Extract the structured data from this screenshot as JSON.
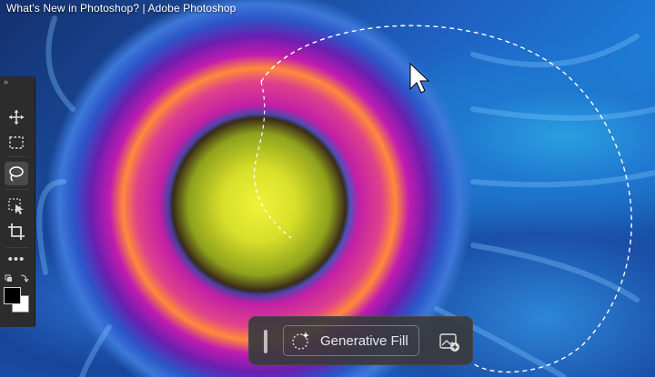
{
  "window": {
    "title": "What's New in Photoshop? | Adobe Photoshop"
  },
  "toolbar": {
    "collapse_glyph": "»",
    "tools": [
      {
        "name": "move-tool",
        "icon": "move-icon",
        "active": false
      },
      {
        "name": "marquee-tool",
        "icon": "rect-marquee-icon",
        "active": false
      },
      {
        "name": "lasso-tool",
        "icon": "lasso-icon",
        "active": true
      },
      {
        "name": "object-selection-tool",
        "icon": "object-select-icon",
        "active": false
      },
      {
        "name": "crop-tool",
        "icon": "crop-icon",
        "active": false
      },
      {
        "name": "more-tools",
        "icon": "more-icon",
        "active": false
      }
    ],
    "more_glyph": "•••",
    "colors": {
      "foreground": "#000000",
      "background": "#ffffff"
    }
  },
  "taskbar": {
    "generative_fill_label": "Generative Fill",
    "icons": [
      "drag-handle-icon",
      "generative-fill-sparkle-icon",
      "add-image-icon"
    ]
  },
  "accent": {
    "toolbar_bg": "#2c2c2c",
    "taskbar_bg": "#3a3a3c"
  }
}
